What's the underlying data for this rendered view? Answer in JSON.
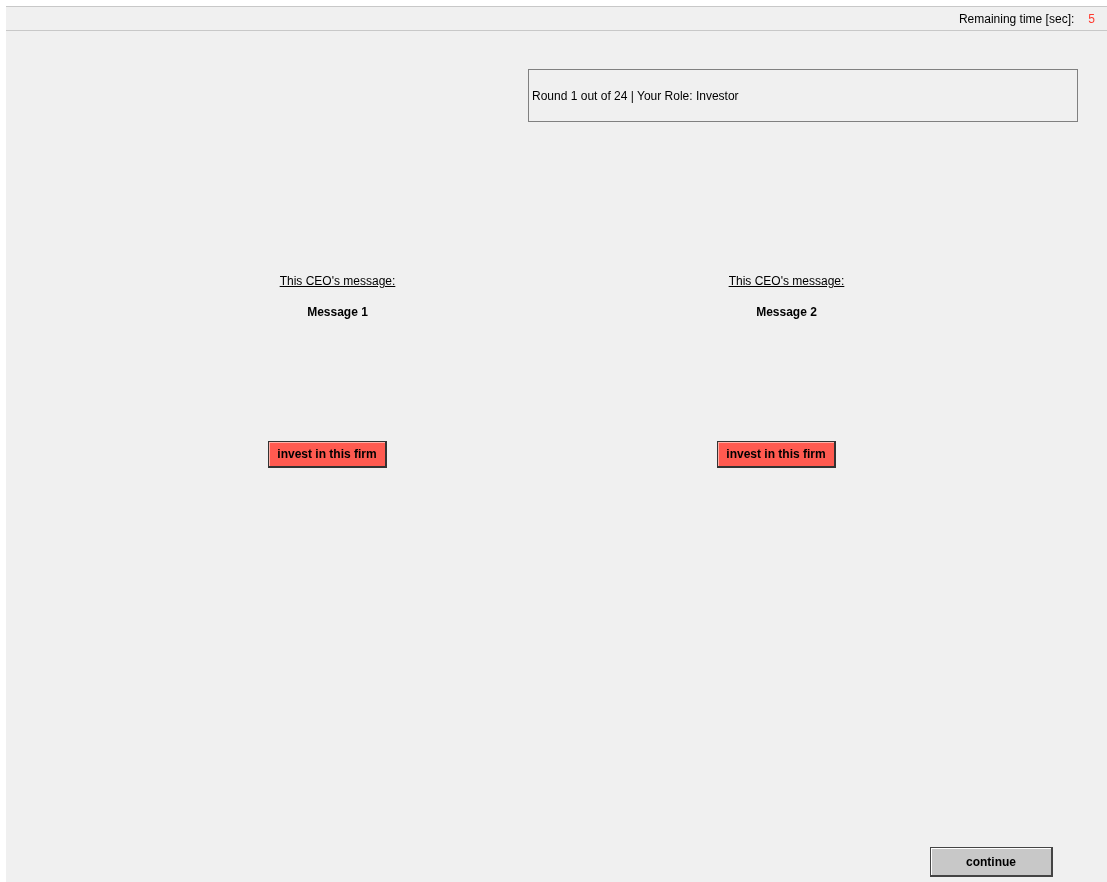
{
  "header": {
    "timer_label": "Remaining time [sec]:",
    "timer_value": "5"
  },
  "info": "Round 1 out of 24 | Your  Role: Investor",
  "firms": [
    {
      "caption": "This CEO's message:",
      "message": "Message 1",
      "button": "invest in this firm"
    },
    {
      "caption": "This CEO's message:",
      "message": "Message 2",
      "button": "invest in this firm"
    }
  ],
  "continue_button": "continue"
}
